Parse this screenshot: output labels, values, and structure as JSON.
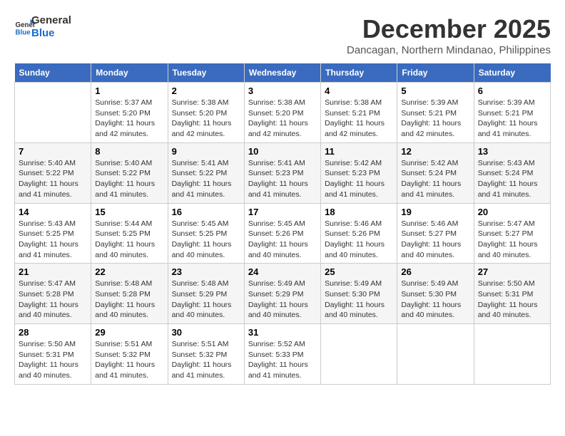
{
  "logo": {
    "line1": "General",
    "line2": "Blue"
  },
  "title": "December 2025",
  "location": "Dancagan, Northern Mindanao, Philippines",
  "days_header": [
    "Sunday",
    "Monday",
    "Tuesday",
    "Wednesday",
    "Thursday",
    "Friday",
    "Saturday"
  ],
  "weeks": [
    [
      {
        "day": "",
        "sunrise": "",
        "sunset": "",
        "daylight": ""
      },
      {
        "day": "1",
        "sunrise": "Sunrise: 5:37 AM",
        "sunset": "Sunset: 5:20 PM",
        "daylight": "Daylight: 11 hours and 42 minutes."
      },
      {
        "day": "2",
        "sunrise": "Sunrise: 5:38 AM",
        "sunset": "Sunset: 5:20 PM",
        "daylight": "Daylight: 11 hours and 42 minutes."
      },
      {
        "day": "3",
        "sunrise": "Sunrise: 5:38 AM",
        "sunset": "Sunset: 5:20 PM",
        "daylight": "Daylight: 11 hours and 42 minutes."
      },
      {
        "day": "4",
        "sunrise": "Sunrise: 5:38 AM",
        "sunset": "Sunset: 5:21 PM",
        "daylight": "Daylight: 11 hours and 42 minutes."
      },
      {
        "day": "5",
        "sunrise": "Sunrise: 5:39 AM",
        "sunset": "Sunset: 5:21 PM",
        "daylight": "Daylight: 11 hours and 42 minutes."
      },
      {
        "day": "6",
        "sunrise": "Sunrise: 5:39 AM",
        "sunset": "Sunset: 5:21 PM",
        "daylight": "Daylight: 11 hours and 41 minutes."
      }
    ],
    [
      {
        "day": "7",
        "sunrise": "Sunrise: 5:40 AM",
        "sunset": "Sunset: 5:22 PM",
        "daylight": "Daylight: 11 hours and 41 minutes."
      },
      {
        "day": "8",
        "sunrise": "Sunrise: 5:40 AM",
        "sunset": "Sunset: 5:22 PM",
        "daylight": "Daylight: 11 hours and 41 minutes."
      },
      {
        "day": "9",
        "sunrise": "Sunrise: 5:41 AM",
        "sunset": "Sunset: 5:22 PM",
        "daylight": "Daylight: 11 hours and 41 minutes."
      },
      {
        "day": "10",
        "sunrise": "Sunrise: 5:41 AM",
        "sunset": "Sunset: 5:23 PM",
        "daylight": "Daylight: 11 hours and 41 minutes."
      },
      {
        "day": "11",
        "sunrise": "Sunrise: 5:42 AM",
        "sunset": "Sunset: 5:23 PM",
        "daylight": "Daylight: 11 hours and 41 minutes."
      },
      {
        "day": "12",
        "sunrise": "Sunrise: 5:42 AM",
        "sunset": "Sunset: 5:24 PM",
        "daylight": "Daylight: 11 hours and 41 minutes."
      },
      {
        "day": "13",
        "sunrise": "Sunrise: 5:43 AM",
        "sunset": "Sunset: 5:24 PM",
        "daylight": "Daylight: 11 hours and 41 minutes."
      }
    ],
    [
      {
        "day": "14",
        "sunrise": "Sunrise: 5:43 AM",
        "sunset": "Sunset: 5:25 PM",
        "daylight": "Daylight: 11 hours and 41 minutes."
      },
      {
        "day": "15",
        "sunrise": "Sunrise: 5:44 AM",
        "sunset": "Sunset: 5:25 PM",
        "daylight": "Daylight: 11 hours and 40 minutes."
      },
      {
        "day": "16",
        "sunrise": "Sunrise: 5:45 AM",
        "sunset": "Sunset: 5:25 PM",
        "daylight": "Daylight: 11 hours and 40 minutes."
      },
      {
        "day": "17",
        "sunrise": "Sunrise: 5:45 AM",
        "sunset": "Sunset: 5:26 PM",
        "daylight": "Daylight: 11 hours and 40 minutes."
      },
      {
        "day": "18",
        "sunrise": "Sunrise: 5:46 AM",
        "sunset": "Sunset: 5:26 PM",
        "daylight": "Daylight: 11 hours and 40 minutes."
      },
      {
        "day": "19",
        "sunrise": "Sunrise: 5:46 AM",
        "sunset": "Sunset: 5:27 PM",
        "daylight": "Daylight: 11 hours and 40 minutes."
      },
      {
        "day": "20",
        "sunrise": "Sunrise: 5:47 AM",
        "sunset": "Sunset: 5:27 PM",
        "daylight": "Daylight: 11 hours and 40 minutes."
      }
    ],
    [
      {
        "day": "21",
        "sunrise": "Sunrise: 5:47 AM",
        "sunset": "Sunset: 5:28 PM",
        "daylight": "Daylight: 11 hours and 40 minutes."
      },
      {
        "day": "22",
        "sunrise": "Sunrise: 5:48 AM",
        "sunset": "Sunset: 5:28 PM",
        "daylight": "Daylight: 11 hours and 40 minutes."
      },
      {
        "day": "23",
        "sunrise": "Sunrise: 5:48 AM",
        "sunset": "Sunset: 5:29 PM",
        "daylight": "Daylight: 11 hours and 40 minutes."
      },
      {
        "day": "24",
        "sunrise": "Sunrise: 5:49 AM",
        "sunset": "Sunset: 5:29 PM",
        "daylight": "Daylight: 11 hours and 40 minutes."
      },
      {
        "day": "25",
        "sunrise": "Sunrise: 5:49 AM",
        "sunset": "Sunset: 5:30 PM",
        "daylight": "Daylight: 11 hours and 40 minutes."
      },
      {
        "day": "26",
        "sunrise": "Sunrise: 5:49 AM",
        "sunset": "Sunset: 5:30 PM",
        "daylight": "Daylight: 11 hours and 40 minutes."
      },
      {
        "day": "27",
        "sunrise": "Sunrise: 5:50 AM",
        "sunset": "Sunset: 5:31 PM",
        "daylight": "Daylight: 11 hours and 40 minutes."
      }
    ],
    [
      {
        "day": "28",
        "sunrise": "Sunrise: 5:50 AM",
        "sunset": "Sunset: 5:31 PM",
        "daylight": "Daylight: 11 hours and 40 minutes."
      },
      {
        "day": "29",
        "sunrise": "Sunrise: 5:51 AM",
        "sunset": "Sunset: 5:32 PM",
        "daylight": "Daylight: 11 hours and 41 minutes."
      },
      {
        "day": "30",
        "sunrise": "Sunrise: 5:51 AM",
        "sunset": "Sunset: 5:32 PM",
        "daylight": "Daylight: 11 hours and 41 minutes."
      },
      {
        "day": "31",
        "sunrise": "Sunrise: 5:52 AM",
        "sunset": "Sunset: 5:33 PM",
        "daylight": "Daylight: 11 hours and 41 minutes."
      },
      {
        "day": "",
        "sunrise": "",
        "sunset": "",
        "daylight": ""
      },
      {
        "day": "",
        "sunrise": "",
        "sunset": "",
        "daylight": ""
      },
      {
        "day": "",
        "sunrise": "",
        "sunset": "",
        "daylight": ""
      }
    ]
  ]
}
